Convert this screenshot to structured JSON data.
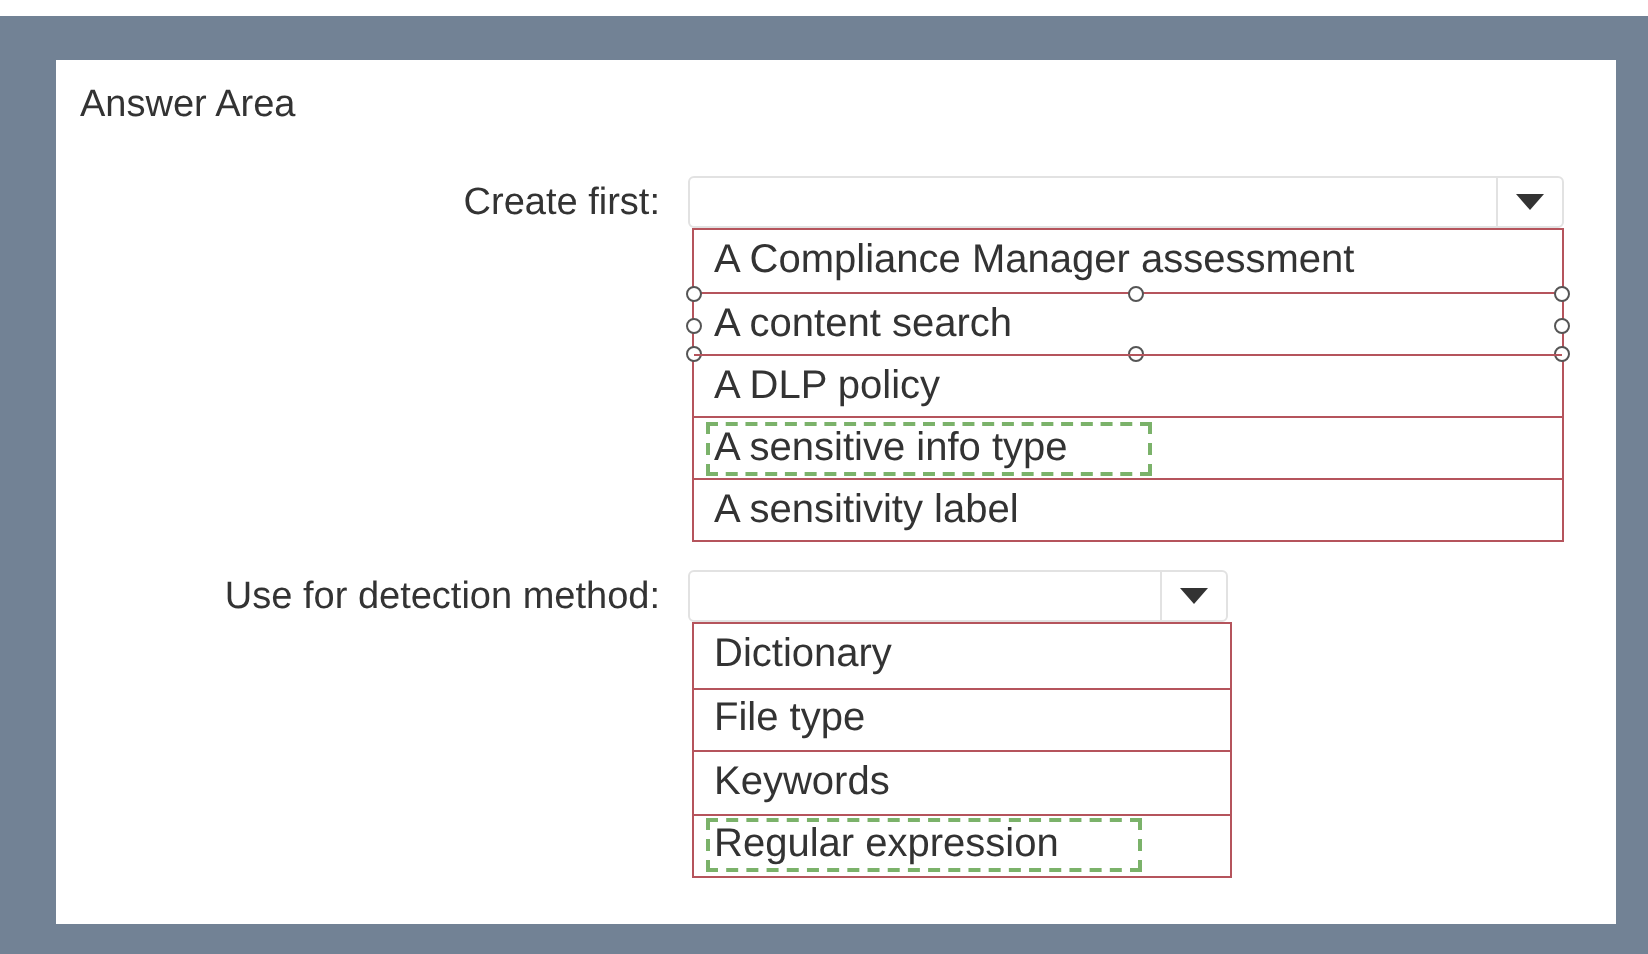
{
  "panel": {
    "title": "Answer Area"
  },
  "questions": [
    {
      "label": "Create first:",
      "options": [
        {
          "text": "A Compliance Manager assessment",
          "selected": false,
          "handles": false
        },
        {
          "text": "A content search",
          "selected": false,
          "handles": true
        },
        {
          "text": "A DLP policy",
          "selected": false,
          "handles": false
        },
        {
          "text": "A sensitive info type",
          "selected": true,
          "handles": false
        },
        {
          "text": "A sensitivity label",
          "selected": false,
          "handles": false
        }
      ]
    },
    {
      "label": "Use for detection method:",
      "options": [
        {
          "text": "Dictionary",
          "selected": false,
          "handles": false
        },
        {
          "text": "File type",
          "selected": false,
          "handles": false
        },
        {
          "text": "Keywords",
          "selected": false,
          "handles": false
        },
        {
          "text": "Regular expression",
          "selected": true,
          "handles": false
        }
      ]
    }
  ]
}
